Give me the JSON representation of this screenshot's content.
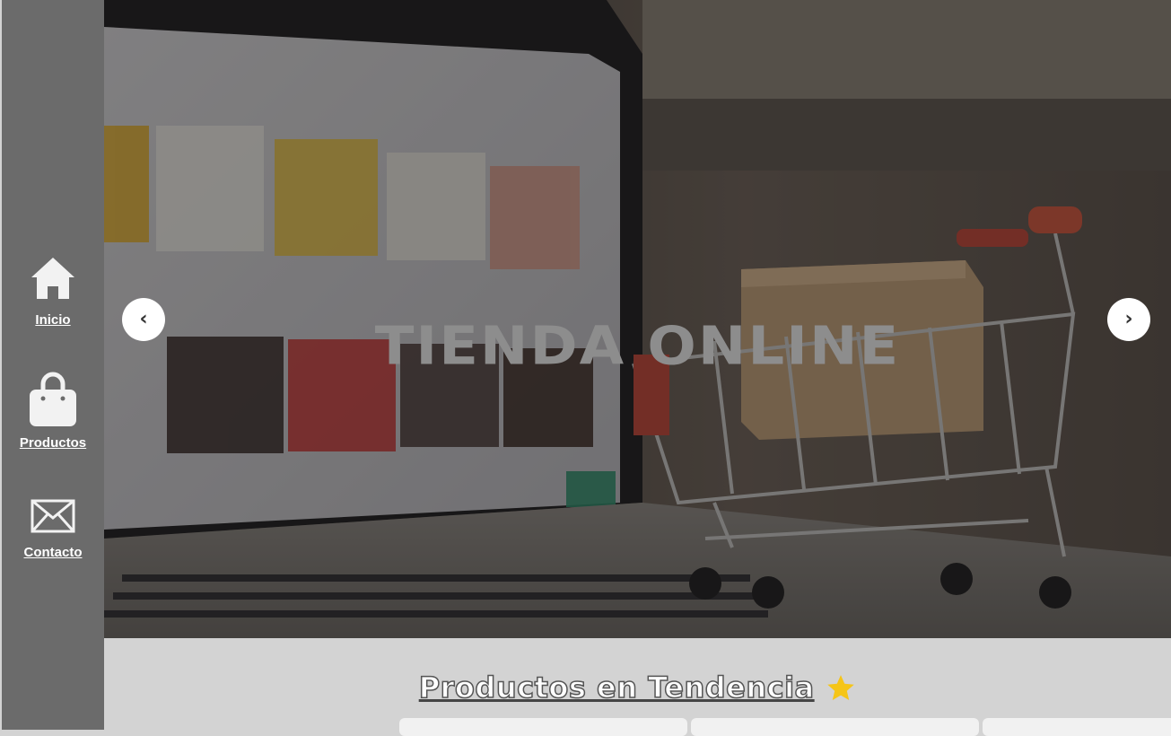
{
  "nav": {
    "items": [
      {
        "label": "Inicio",
        "icon": "home-icon"
      },
      {
        "label": "Productos",
        "icon": "shopping-bag-icon"
      },
      {
        "label": "Contacto",
        "icon": "envelope-icon"
      }
    ]
  },
  "hero": {
    "title": "TIENDA ONLINE",
    "prev_label": "‹",
    "next_label": "›"
  },
  "trending": {
    "title": "Productos en Tendencia",
    "icon": "star-icon"
  },
  "colors": {
    "sidebar": "#6b6b6b",
    "section_bg": "#d3d3d3",
    "star": "#f5c518"
  }
}
